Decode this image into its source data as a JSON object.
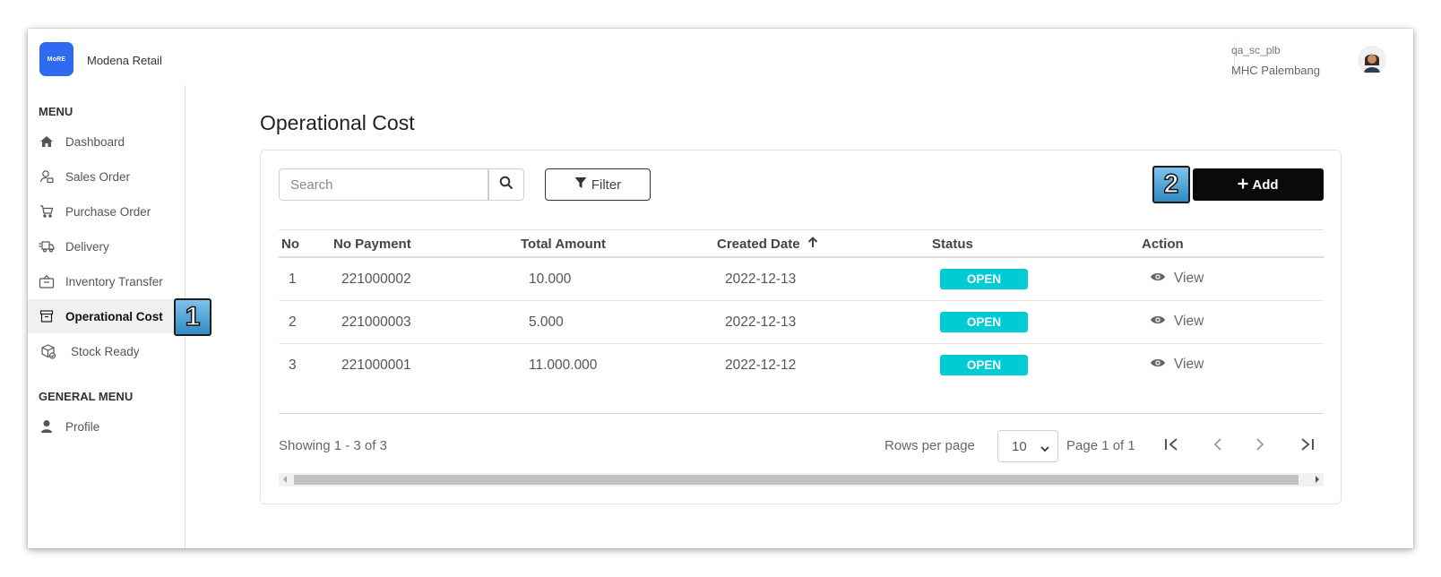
{
  "app": {
    "logo_text": "MoRE",
    "name": "Modena Retail",
    "brand_color": "#2f6bf0"
  },
  "user": {
    "username": "qa_sc_plb",
    "location": "MHC Palembang"
  },
  "sidebar": {
    "menu_heading": "MENU",
    "items": [
      {
        "label": "Dashboard",
        "icon": "home-icon"
      },
      {
        "label": "Sales Order",
        "icon": "sales-order-icon"
      },
      {
        "label": "Purchase Order",
        "icon": "cart-icon"
      },
      {
        "label": "Delivery",
        "icon": "truck-icon"
      },
      {
        "label": "Inventory Transfer",
        "icon": "box-transfer-icon"
      },
      {
        "label": "Operational Cost",
        "icon": "archive-icon",
        "active": true
      },
      {
        "label": "Stock Ready",
        "icon": "package-check-icon"
      }
    ],
    "general_heading": "GENERAL MENU",
    "general_items": [
      {
        "label": "Profile",
        "icon": "user-icon"
      }
    ]
  },
  "page": {
    "title": "Operational Cost"
  },
  "toolbar": {
    "search_placeholder": "Search",
    "filter_label": "Filter",
    "add_label": "Add"
  },
  "markers": {
    "one": "1",
    "two": "2"
  },
  "table": {
    "headers": [
      "No",
      "No Payment",
      "Total Amount",
      "Created Date",
      "Status",
      "Action"
    ],
    "rows": [
      {
        "no": "1",
        "no_payment": "221000002",
        "total_amount": "10.000",
        "created_date": "2022-12-13",
        "status": "OPEN",
        "action": "View"
      },
      {
        "no": "2",
        "no_payment": "221000003",
        "total_amount": "5.000",
        "created_date": "2022-12-13",
        "status": "OPEN",
        "action": "View"
      },
      {
        "no": "3",
        "no_payment": "221000001",
        "total_amount": "11.000.000",
        "created_date": "2022-12-12",
        "status": "OPEN",
        "action": "View"
      }
    ],
    "status_color": "#00ccd3"
  },
  "pagination": {
    "showing": "Showing 1 - 3 of 3",
    "rows_per_page_label": "Rows per page",
    "rows_per_page_value": "10",
    "page_info": "Page 1 of 1"
  }
}
